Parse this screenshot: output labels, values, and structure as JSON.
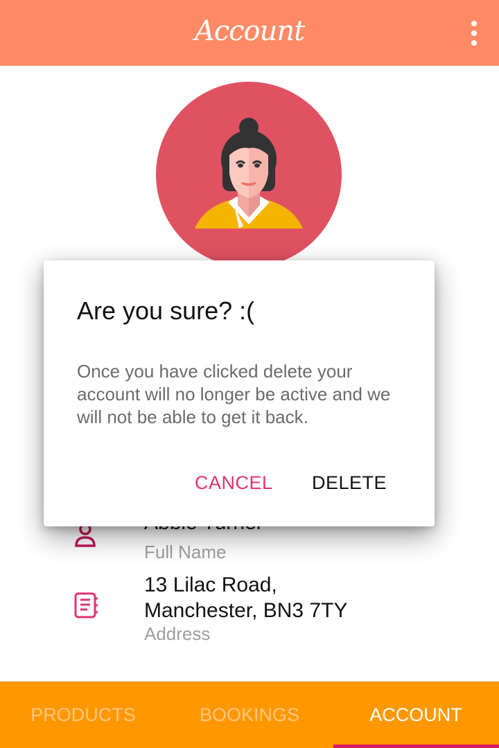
{
  "app_bar": {
    "title": "Account",
    "menu_icon": "more-vert-icon"
  },
  "profile": {
    "avatar_icon": "woman-avatar",
    "avatar_bg": "#e05261"
  },
  "fields": [
    {
      "icon": "person-icon",
      "value": "Abbie Turner",
      "label": "Full Name"
    },
    {
      "icon": "notebook-icon",
      "value_line1": "13 Lilac Road,",
      "value_line2": "Manchester, BN3 7TY",
      "label": "Address"
    }
  ],
  "dialog": {
    "title": "Are you sure? :(",
    "message": "Once you have clicked delete your account will no longer be active and we will not be able to get it back.",
    "cancel_label": "CANCEL",
    "delete_label": "DELETE"
  },
  "bottom_nav": {
    "tabs": [
      {
        "label": "PRODUCTS",
        "active": false
      },
      {
        "label": "BOOKINGS",
        "active": false
      },
      {
        "label": "ACCOUNT",
        "active": true
      }
    ]
  },
  "colors": {
    "app_bar": "#ff8a65",
    "bottom_nav": "#ff9800",
    "accent": "#d81b60"
  }
}
